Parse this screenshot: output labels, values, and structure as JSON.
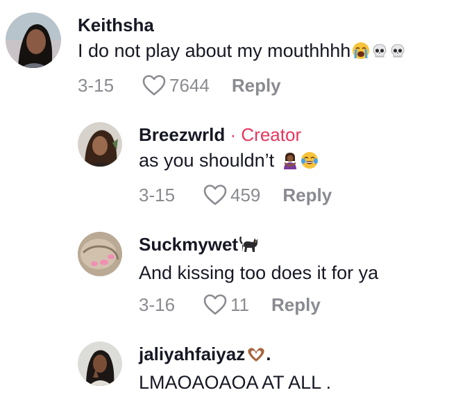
{
  "comments": [
    {
      "username": "Keithsha",
      "text": "I do not play about my mouthhhh",
      "date": "3-15",
      "likes": "7644",
      "reply_label": "Reply",
      "emojis": [
        "loudly-crying-face-icon",
        "skull-icon",
        "skull-icon"
      ]
    },
    {
      "username": "Breezwrld",
      "separator": "·",
      "badge": "Creator",
      "text": "as you shouldn’t",
      "date": "3-15",
      "likes": "459",
      "reply_label": "Reply",
      "emojis": [
        "person-gesturing-no-icon",
        "face-with-tears-of-joy-icon"
      ]
    },
    {
      "username": "Suckmywet",
      "text": "And kissing too does it for ya",
      "date": "3-16",
      "likes": "11",
      "reply_label": "Reply",
      "emojis": [
        "black-cat-icon"
      ]
    },
    {
      "username": "jaliyahfaiyaz",
      "username_suffix": ".",
      "text": "LMAOAOAOA AT ALL .",
      "emojis": [
        "heart-hands-icon"
      ]
    }
  ],
  "colors": {
    "creator": "#e8355d",
    "meta": "#8a8b91",
    "text": "#161823"
  }
}
